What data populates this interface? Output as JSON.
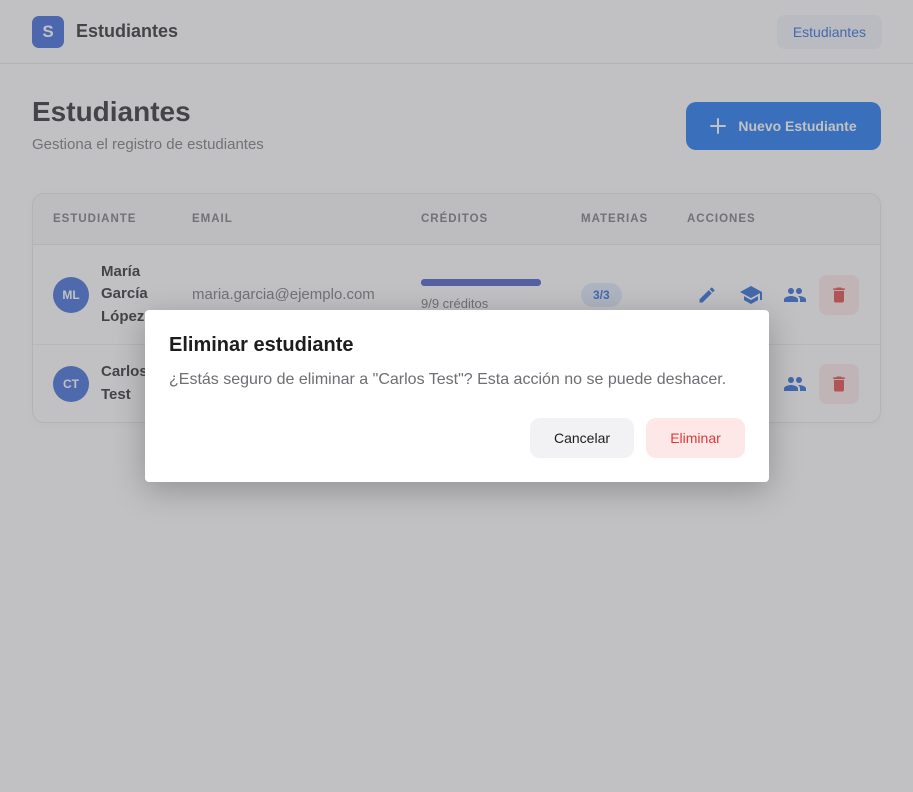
{
  "app": {
    "logo_letter": "S",
    "name": "Estudiantes",
    "nav_link": "Estudiantes"
  },
  "header": {
    "title": "Estudiantes",
    "subtitle": "Gestiona el registro de estudiantes",
    "new_button": "Nuevo Estudiante"
  },
  "table": {
    "columns": [
      "ESTUDIANTE",
      "EMAIL",
      "CRÉDITOS",
      "MATERIAS",
      "ACCIONES"
    ],
    "rows": [
      {
        "initials": "ML",
        "name": "María García López",
        "email": "maria.garcia@ejemplo.com",
        "credits_text": "9/9 créditos",
        "credits_fraction": 1.0,
        "subjects": "3/3"
      },
      {
        "initials": "CT",
        "name": "Carlos Test"
      }
    ]
  },
  "dialog": {
    "title": "Eliminar estudiante",
    "message": "¿Estás seguro de eliminar a \"Carlos Test\"? Esta acción no se puede deshacer.",
    "cancel": "Cancelar",
    "confirm": "Eliminar"
  },
  "colors": {
    "primary": "#0a6cf0",
    "danger": "#e0393a",
    "danger_bg": "#fde7e7",
    "avatar": "#2f5fd6"
  }
}
